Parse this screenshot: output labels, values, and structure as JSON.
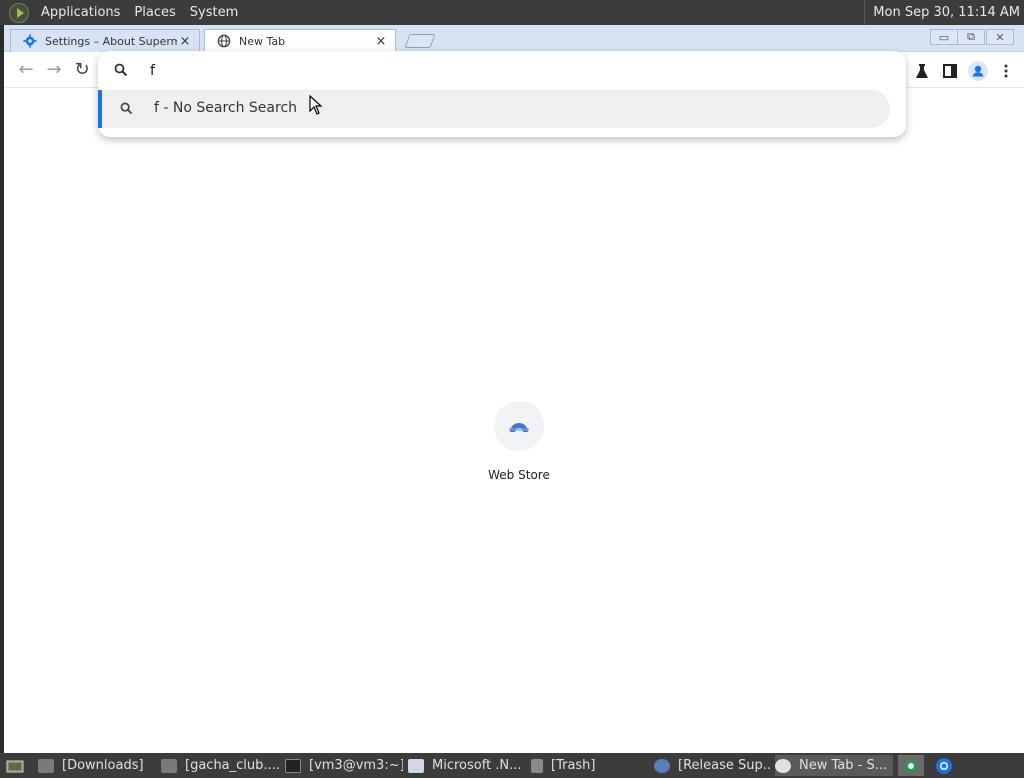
{
  "top_panel": {
    "menus": [
      "Applications",
      "Places",
      "System"
    ],
    "clock": "Mon Sep 30, 11:14 AM"
  },
  "browser": {
    "tabs": [
      {
        "title": "Settings – About Superm",
        "icon": "gear-icon",
        "close": "×"
      },
      {
        "title": "New Tab",
        "icon": "globe-icon",
        "close": "×"
      }
    ],
    "window_controls": {
      "minimize": "▭",
      "restore": "⧉",
      "close": "✕"
    },
    "omnibox": {
      "value": "f",
      "suggestion": "f - No Search Search"
    },
    "shortcut": {
      "label": "Web Store"
    },
    "accent_color": "#1a73e8"
  },
  "taskbar": {
    "tasks": [
      {
        "label": "[Downloads]",
        "icon": "folder-icon"
      },
      {
        "label": "[gacha_club....",
        "icon": "folder-icon"
      },
      {
        "label": "[vm3@vm3:~]",
        "icon": "terminal-icon"
      },
      {
        "label": "Microsoft .N...",
        "icon": "document-icon"
      },
      {
        "label": "[Trash]",
        "icon": "trash-icon"
      },
      {
        "label": "[Release Sup...",
        "icon": "browser-icon"
      },
      {
        "label": "New Tab - S...",
        "icon": "browser-icon"
      }
    ]
  }
}
